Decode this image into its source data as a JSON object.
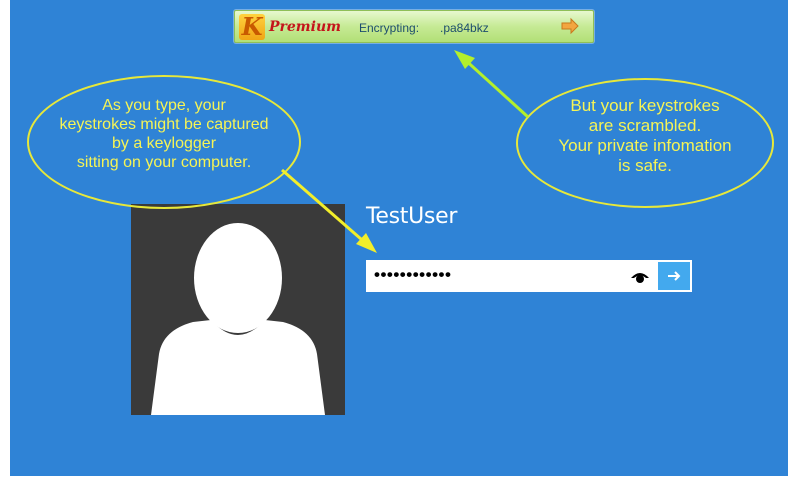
{
  "toolbar": {
    "logo_letter": "K",
    "premium_label": "Premium",
    "encrypting_label": "Encrypting:",
    "encrypting_value": ".pa84bkz"
  },
  "login": {
    "username": "TestUser",
    "password_masked": "••••••••••••"
  },
  "callouts": {
    "left": [
      "As you type, your",
      "keystrokes might be captured",
      "by a keylogger",
      "sitting on your computer."
    ],
    "right": [
      "But your keystrokes",
      "are scrambled.",
      "Your private infomation",
      "is safe."
    ]
  },
  "colors": {
    "background": "#2f83d6",
    "callout_outline": "#e7e83a",
    "callout_text": "#f6f455",
    "submit_button": "#43a9ee",
    "avatar_bg": "#3a3a3a"
  },
  "icons": {
    "toolbar_arrow": "right-arrow-icon",
    "eye": "eye-icon",
    "submit": "arrow-right-icon"
  }
}
